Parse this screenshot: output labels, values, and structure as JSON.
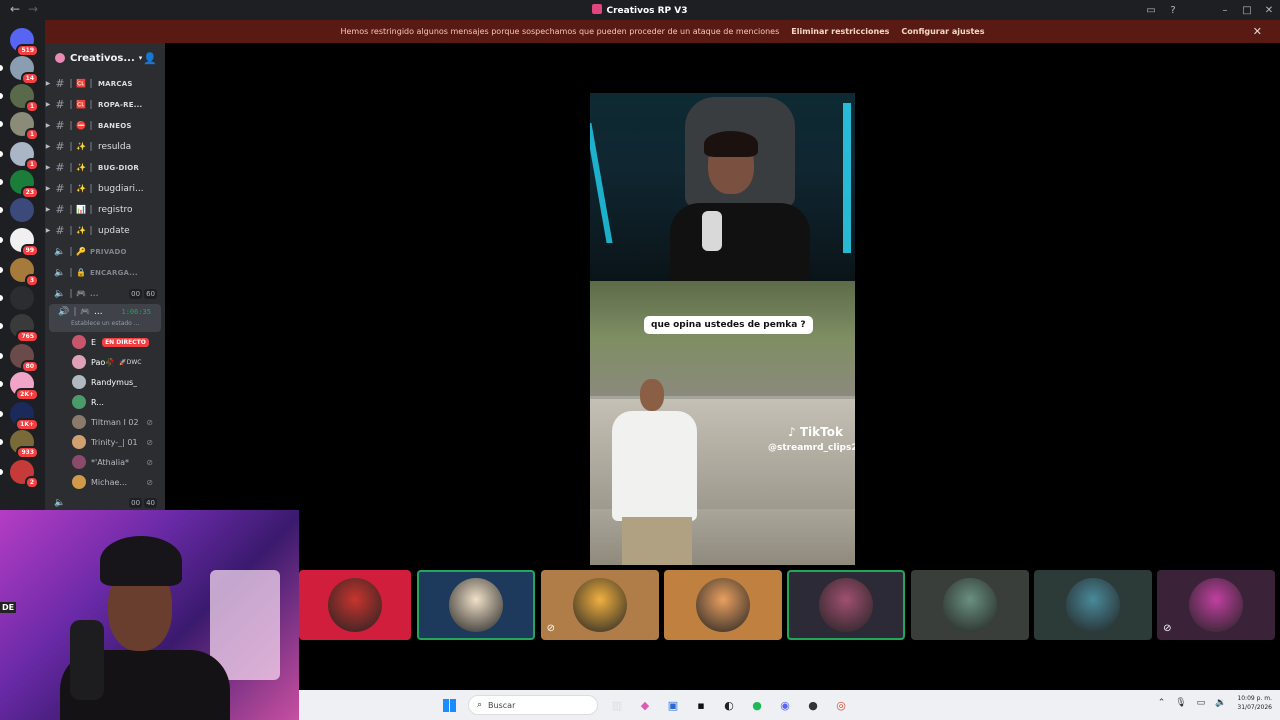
{
  "window": {
    "title": "Creativos RP V3"
  },
  "banner": {
    "message": "Hemos restringido algunos mensajes porque sospechamos que pueden proceder de un ataque de menciones",
    "action_remove": "Eliminar restricciones",
    "action_settings": "Configurar ajustes"
  },
  "servers": [
    {
      "badge": "519",
      "color": "#5865f2"
    },
    {
      "badge": "14",
      "color": "#8a9db1"
    },
    {
      "badge": "1",
      "color": "#596a4a"
    },
    {
      "badge": "1",
      "color": "#8b8b7a"
    },
    {
      "badge": "1",
      "color": "#aab6c5"
    },
    {
      "badge": "23",
      "color": "#1a7d3a"
    },
    {
      "badge": "",
      "color": "#3b4a7a"
    },
    {
      "badge": "99",
      "color": "#f0f0f0"
    },
    {
      "badge": "3",
      "color": "#a57a3a"
    },
    {
      "badge": "",
      "color": "#2b2d31"
    },
    {
      "badge": "765",
      "color": "#3a3a3a"
    },
    {
      "badge": "80",
      "color": "#6b4a4a"
    },
    {
      "badge": "2K+",
      "color": "#f0a5c8"
    },
    {
      "badge": "1K+",
      "color": "#1b2a5a"
    },
    {
      "badge": "933",
      "color": "#7a6a3a"
    },
    {
      "badge": "2",
      "color": "#c73a3a"
    }
  ],
  "sidebar": {
    "server_name": "Creativos...",
    "channels": [
      {
        "emoji": "🆑",
        "name": "MARCAS",
        "small": true
      },
      {
        "emoji": "🆑",
        "name": "ROPA-RE...",
        "small": true
      },
      {
        "emoji": "⛔",
        "name": "BANEOS",
        "small": true
      },
      {
        "emoji": "✨",
        "name": "resulda",
        "small": false
      },
      {
        "emoji": "✨",
        "name": "BUG-DIOR",
        "small": true
      },
      {
        "emoji": "✨",
        "name": "bugdiari...",
        "small": false
      },
      {
        "emoji": "📊",
        "name": "registro",
        "small": false
      },
      {
        "emoji": "✨",
        "name": "update",
        "small": false
      }
    ],
    "voice_channels": [
      {
        "emoji": "🔑",
        "name": "PRIVADO"
      },
      {
        "emoji": "🔒",
        "name": "ENCARGA..."
      },
      {
        "emoji": "🎮",
        "name": "...",
        "count_a": "00",
        "count_b": "60"
      }
    ],
    "active_voice": {
      "name": "...",
      "timer": "1:06:35",
      "status": "Establece un estado ..."
    },
    "participants": [
      {
        "name": "E",
        "live": "EN DIRECTO",
        "color": "#c8556a"
      },
      {
        "name": "Pao🥀",
        "tag": "🚀DWC",
        "color": "#e0a0b5"
      },
      {
        "name": "Randymus_",
        "color": "#b0b8c0"
      },
      {
        "name": "R...",
        "color": "#4a9a6a"
      },
      {
        "name": "Tiltman I 02",
        "color": "#8a7a6a"
      },
      {
        "name": "Trinity-_| 01",
        "color": "#d0a070"
      },
      {
        "name": "*'Athalia*",
        "color": "#8a4a6a"
      },
      {
        "name": "Michae...",
        "color": "#d09a4a"
      }
    ],
    "partial_row": {
      "count_a": "00",
      "count_b": "40"
    }
  },
  "stream": {
    "caption": "que opina ustedes de pemka ?",
    "watermark": "TikTok",
    "handle": "@streamrd_clips2"
  },
  "tiles": [
    {
      "bg": "#d01e3c",
      "avatar": "#c8342e",
      "muted": false,
      "speaking": false
    },
    {
      "bg": "#1d3a5c",
      "avatar": "#f0e0c8",
      "muted": false,
      "speaking": true
    },
    {
      "bg": "#b07c48",
      "avatar": "#f0b040",
      "muted": true,
      "speaking": false
    },
    {
      "bg": "#c08040",
      "avatar": "#e8a060",
      "muted": false,
      "speaking": false
    },
    {
      "bg": "#2c2a36",
      "avatar": "#a05070",
      "muted": false,
      "speaking": true
    },
    {
      "bg": "#3a3e3a",
      "avatar": "#6a9080",
      "muted": false,
      "speaking": false
    },
    {
      "bg": "#2c3a38",
      "avatar": "#4a8a9a",
      "muted": false,
      "speaking": false
    },
    {
      "bg": "#3a2238",
      "avatar": "#c040a0",
      "muted": true,
      "speaking": false
    }
  ],
  "webcam": {
    "sign": "DE"
  },
  "taskbar": {
    "search_placeholder": "Buscar",
    "time": "10:09 p. m.",
    "date": "31/07/2026"
  }
}
